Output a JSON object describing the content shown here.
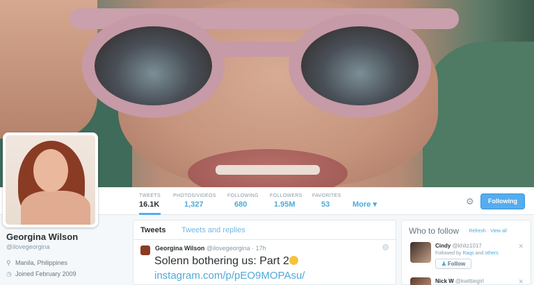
{
  "profile": {
    "name": "Georgina Wilson",
    "handle": "@ilovegeorgina",
    "location": "Manila, Philippines",
    "joined": "Joined February 2009"
  },
  "stats": [
    {
      "label": "TWEETS",
      "value": "16.1K"
    },
    {
      "label": "PHOTOS/VIDEOS",
      "value": "1,327"
    },
    {
      "label": "FOLLOWING",
      "value": "680"
    },
    {
      "label": "FOLLOWERS",
      "value": "1.95M"
    },
    {
      "label": "FAVORITES",
      "value": "53"
    }
  ],
  "nav": {
    "more_label": "More",
    "following_button": "Following"
  },
  "timeline": {
    "tabs": [
      "Tweets",
      "Tweets and replies"
    ],
    "tweet": {
      "name": "Georgina Wilson",
      "handle": "@ilovegeorgina",
      "time": "17h",
      "text": "Solenn bothering us: Part 2",
      "link": "instagram.com/p/pEO9MOPAsu/"
    }
  },
  "who_to_follow": {
    "title": "Who to follow",
    "refresh": "Refresh",
    "view_all": "View all",
    "suggestions": [
      {
        "name": "Cindy",
        "handle": "@khitz1017",
        "followed_by_prefix": "Followed by",
        "followed_by": "Raqs",
        "and_text": "and",
        "others": "others",
        "button": "Follow"
      },
      {
        "name": "Nick W",
        "handle": "@kwittiegirl"
      }
    ]
  },
  "icons": {
    "location": "location-pin-icon",
    "calendar": "calendar-icon",
    "gear": "gear-icon",
    "close": "close-icon",
    "chevron": "chevron-down-icon",
    "person_add": "person-add-icon"
  },
  "colors": {
    "accent": "#55acee",
    "link": "#4fa9d9",
    "text": "#292f33",
    "muted": "#8899a6"
  }
}
